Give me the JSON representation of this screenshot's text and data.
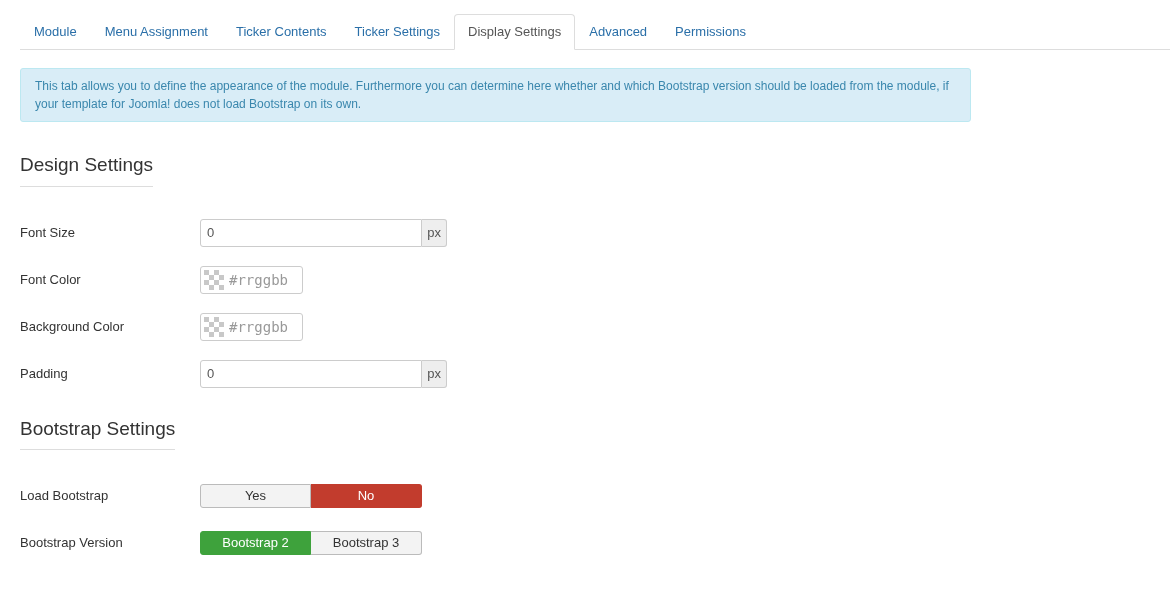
{
  "tabs": [
    {
      "label": "Module",
      "selected": false
    },
    {
      "label": "Menu Assignment",
      "selected": false
    },
    {
      "label": "Ticker Contents",
      "selected": false
    },
    {
      "label": "Ticker Settings",
      "selected": false
    },
    {
      "label": "Display Settings",
      "selected": true
    },
    {
      "label": "Advanced",
      "selected": false
    },
    {
      "label": "Permissions",
      "selected": false
    }
  ],
  "alert": "This tab allows you to define the appearance of the module. Furthermore you can determine here whether and which Bootstrap version should be loaded from the module, if your template for Joomla! does not load Bootstrap on its own.",
  "sections": [
    {
      "title": "Design Settings",
      "fields": [
        {
          "kind": "number",
          "label": "Font Size",
          "value": "0",
          "unit": "px"
        },
        {
          "kind": "color",
          "label": "Font Color",
          "placeholder": "#rrggbb"
        },
        {
          "kind": "color",
          "label": "Background Color",
          "placeholder": "#rrggbb"
        },
        {
          "kind": "number",
          "label": "Padding",
          "value": "0",
          "unit": "px"
        }
      ]
    },
    {
      "title": "Bootstrap Settings",
      "fields": [
        {
          "kind": "toggle",
          "label": "Load Bootstrap",
          "color": "#c23c2d",
          "options": [
            {
              "label": "Yes",
              "selected": false
            },
            {
              "label": "No",
              "selected": true
            }
          ]
        },
        {
          "kind": "toggle",
          "label": "Bootstrap Version",
          "color": "#3ea23c",
          "options": [
            {
              "label": "Bootstrap 2",
              "selected": true
            },
            {
              "label": "Bootstrap 3",
              "selected": false
            }
          ]
        }
      ]
    }
  ]
}
